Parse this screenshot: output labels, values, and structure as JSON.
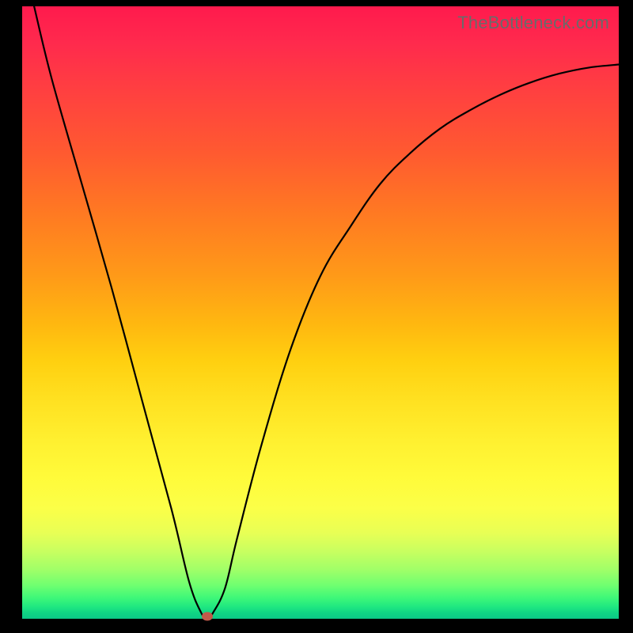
{
  "watermark": "TheBottleneck.com",
  "colors": {
    "frame": "#000000",
    "curve_stroke": "#000000",
    "dot": "#c05a4a",
    "watermark_text": "#6a6a6a"
  },
  "chart_data": {
    "type": "line",
    "title": "",
    "xlabel": "",
    "ylabel": "",
    "xlim": [
      0,
      100
    ],
    "ylim": [
      0,
      100
    ],
    "grid": false,
    "series": [
      {
        "name": "bottleneck-curve",
        "x": [
          2,
          5,
          10,
          15,
          20,
          25,
          28,
          30,
          31,
          32,
          34,
          36,
          40,
          45,
          50,
          55,
          60,
          65,
          70,
          75,
          80,
          85,
          90,
          95,
          100
        ],
        "y": [
          100,
          88,
          71,
          54,
          36,
          18,
          6,
          1,
          0,
          1,
          5,
          13,
          28,
          44,
          56,
          64,
          71,
          76,
          80,
          83,
          85.5,
          87.5,
          89,
          90,
          90.5
        ]
      }
    ],
    "marker": {
      "x": 31,
      "y": 0
    },
    "background_gradient_meaning": "severity heatmap (red=high, green=low)"
  }
}
